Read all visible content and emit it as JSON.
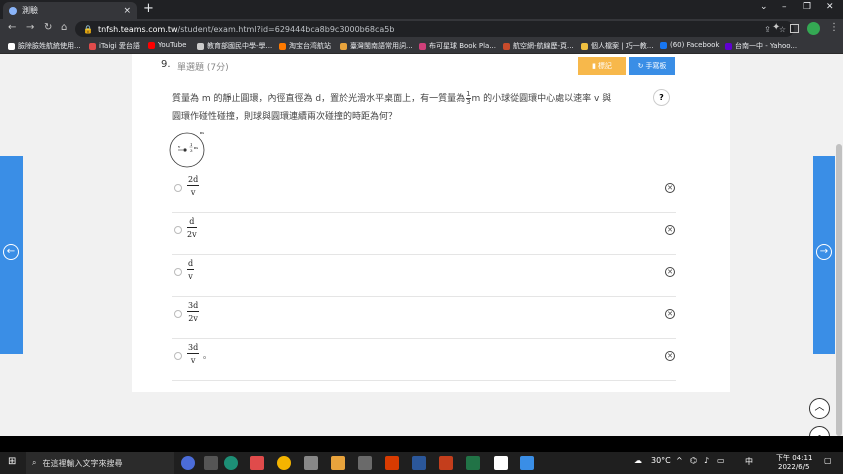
{
  "browser": {
    "tab_title": "測驗",
    "tab_close": "×",
    "new_tab": "+",
    "url_domain": "tnfsh.teams.com.tw",
    "url_path": "/student/exam.html?id=629444bca8b9c3000b68ca5b",
    "window_controls": [
      "⌄",
      "–",
      "❐",
      "✕"
    ],
    "bookmarks": [
      {
        "label": "臉除臉姓航統使用...",
        "color": "#ffffff"
      },
      {
        "label": "iTaigi 愛台語",
        "color": "#e04b4b"
      },
      {
        "label": "YouTube",
        "color": "#ff0000"
      },
      {
        "label": "教育部國民中學-學...",
        "color": "#cccccc"
      },
      {
        "label": "淘宝台湾航站",
        "color": "#ff7a00"
      },
      {
        "label": "臺灣閩南語常用詞...",
        "color": "#e8a33c"
      },
      {
        "label": "布可星球 Book Pla...",
        "color": "#d0407a"
      },
      {
        "label": "航空網-航線歷-頁...",
        "color": "#c84b2b"
      },
      {
        "label": "個人檔案 | 巧一教...",
        "color": "#f0c040"
      },
      {
        "label": "(60) Facebook",
        "color": "#1877f2"
      },
      {
        "label": "台南一中 - Yahoo...",
        "color": "#6001d2"
      }
    ]
  },
  "question": {
    "number": "9.",
    "type": "單選題 (7分)",
    "mark_button": "標記",
    "hand_button": "手寫板",
    "help": "?",
    "text_part1": "質量為 m 的靜止圓環，內徑直徑為 d，置於光滑水平桌面上，有一質量為",
    "frac_num": "1",
    "frac_den": "3",
    "text_part2": "m 的小球從圓環中心處以速率 v 與",
    "text_line2": "圓環作碰性碰撞，則球與圓環連續兩次碰撞的時距為何？",
    "figure": {
      "ball_label": "v",
      "mass_num": "1",
      "mass_den": "3",
      "mass_unit": "m",
      "ring_label": "m"
    }
  },
  "options": [
    {
      "num": "2d",
      "den": "v",
      "suffix": ""
    },
    {
      "num": "d",
      "den": "2v",
      "suffix": ""
    },
    {
      "num": "d",
      "den": "v",
      "suffix": ""
    },
    {
      "num": "3d",
      "den": "2v",
      "suffix": ""
    },
    {
      "num": "3d",
      "den": "v",
      "suffix": "。"
    }
  ],
  "nav": {
    "prev": "←",
    "next": "→",
    "scroll_up": "︿"
  },
  "taskbar": {
    "search_placeholder": "在這裡輸入文字來搜尋",
    "weather": "30°C",
    "time": "下午 04:11",
    "date": "2022/6/5",
    "ime": "中"
  },
  "colors": {
    "accent": "#3a8ee6",
    "mark": "#f7b84b"
  }
}
